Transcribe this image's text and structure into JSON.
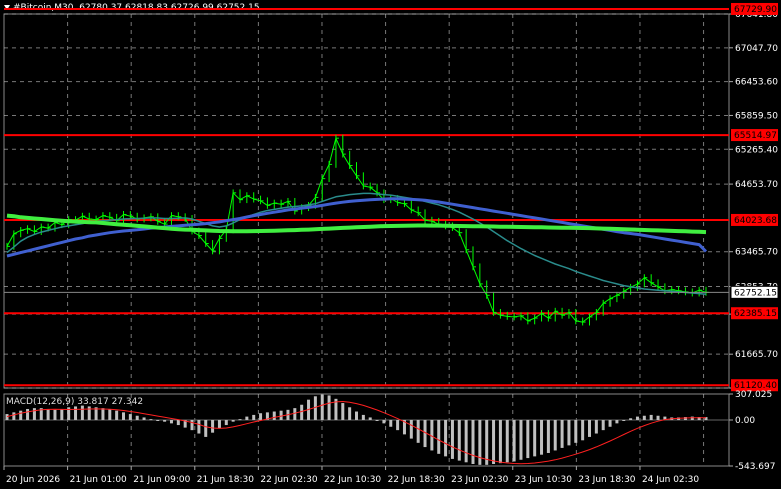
{
  "header": {
    "symbol_timeframe": "#Bitcoin,M30",
    "ohlc": "62780.37 62818.83 62726.99 62752.15"
  },
  "price_axis": {
    "ticks": [
      "67641.80",
      "67047.70",
      "66453.60",
      "65859.50",
      "65265.40",
      "64653.70",
      "63465.70",
      "62853.70",
      "62369.50",
      "61665.70",
      "61071.60"
    ],
    "current_price": "62752.15"
  },
  "levels": [
    {
      "label": "67729.90",
      "price": 67729.9
    },
    {
      "label": "65514.97",
      "price": 65514.97
    },
    {
      "label": "64023.68",
      "price": 64023.68
    },
    {
      "label": "62385.15",
      "price": 62385.15
    },
    {
      "label": "61120.40",
      "price": 61120.4
    }
  ],
  "macd": {
    "label": "MACD(12,26,9) 33.817 27.342",
    "ticks": [
      "307.025",
      "0.00",
      "-543.697"
    ]
  },
  "time_axis": [
    "20 Jun 2026",
    "21 Jun 01:00",
    "21 Jun 09:00",
    "21 Jun 18:30",
    "22 Jun 02:30",
    "22 Jun 10:30",
    "22 Jun 18:30",
    "23 Jun 02:30",
    "23 Jun 10:30",
    "23 Jun 18:30",
    "24 Jun 02:30"
  ],
  "colors": {
    "background": "#000000",
    "grid": "#c8c8c8",
    "level": "#ff0000",
    "candles": "#00ff00",
    "ma_fast": "#2a8c8c",
    "ma_mid": "#4060d0",
    "ma_slow": "#40ee40",
    "macd_hist": "#c0c0c0",
    "macd_signal": "#ff2020"
  },
  "chart_data": {
    "type": "line",
    "series": [
      {
        "values": [
          63560,
          63780,
          63840,
          63870,
          63820,
          63900,
          63880,
          63980,
          63940,
          64030,
          64020,
          64090,
          64040,
          64030,
          64100,
          64070,
          64010,
          64120,
          64090,
          64040,
          64060,
          64080,
          64000,
          63950,
          64100,
          64080,
          64050,
          63830,
          63750,
          63610,
          63480,
          63700,
          63850,
          64500,
          64380,
          64450,
          64390,
          64360,
          64280,
          64320,
          64300,
          64350,
          64180,
          64240,
          64280,
          64420,
          64750,
          65000,
          65460,
          65180,
          64980,
          64800,
          64620,
          64600,
          64500,
          64380,
          64400,
          64330,
          64310,
          64200,
          64150,
          64020,
          64000,
          63950,
          63920,
          63890,
          63800,
          63500,
          63200,
          62900,
          62700,
          62400,
          62350,
          62330,
          62320,
          62340,
          62250,
          62300,
          62380,
          62300,
          62420,
          62350,
          62400,
          62250,
          62230,
          62320,
          62400,
          62560,
          62640,
          62700,
          62770,
          62840,
          62900,
          63010,
          62920,
          62850,
          62780,
          62800,
          62780,
          62760,
          62740,
          62790,
          62752
        ]
      },
      {
        "values": [
          63450,
          63550,
          63650,
          63720,
          63770,
          63810,
          63840,
          63870,
          63900,
          63920,
          63940,
          63960,
          63980,
          64000,
          64010,
          64020,
          64030,
          64040,
          64045,
          64050,
          64055,
          64060,
          64058,
          64050,
          64050,
          64055,
          64060,
          64040,
          64000,
          63960,
          63920,
          63900,
          63920,
          63970,
          64030,
          64080,
          64120,
          64160,
          64190,
          64210,
          64230,
          64250,
          64260,
          64270,
          64290,
          64310,
          64350,
          64390,
          64430,
          64450,
          64470,
          64480,
          64490,
          64490,
          64480,
          64470,
          64460,
          64440,
          64420,
          64400,
          64380,
          64350,
          64320,
          64290,
          64250,
          64210,
          64160,
          64100,
          64040,
          63970,
          63900,
          63820,
          63740,
          63660,
          63590,
          63520,
          63460,
          63400,
          63350,
          63300,
          63250,
          63210,
          63170,
          63120,
          63080,
          63040,
          63000,
          62960,
          62930,
          62900,
          62870,
          62850,
          62830,
          62810,
          62800,
          62790,
          62780,
          62770,
          62760,
          62750,
          62740,
          62730,
          62720
        ]
      },
      {
        "values": [
          63390,
          63420,
          63450,
          63480,
          63510,
          63540,
          63570,
          63600,
          63630,
          63660,
          63690,
          63710,
          63740,
          63760,
          63780,
          63800,
          63815,
          63830,
          63840,
          63850,
          63865,
          63880,
          63890,
          63900,
          63910,
          63920,
          63930,
          63940,
          63950,
          63960,
          63975,
          63990,
          64010,
          64030,
          64050,
          64075,
          64100,
          64120,
          64140,
          64160,
          64180,
          64200,
          64215,
          64230,
          64245,
          64260,
          64280,
          64300,
          64320,
          64335,
          64350,
          64360,
          64370,
          64380,
          64385,
          64390,
          64395,
          64395,
          64390,
          64385,
          64380,
          64370,
          64355,
          64340,
          64320,
          64300,
          64280,
          64260,
          64240,
          64220,
          64200,
          64180,
          64160,
          64140,
          64120,
          64100,
          64080,
          64060,
          64040,
          64020,
          64000,
          63980,
          63960,
          63940,
          63920,
          63900,
          63880,
          63860,
          63840,
          63820,
          63800,
          63785,
          63770,
          63750,
          63730,
          63710,
          63690,
          63670,
          63650,
          63630,
          63610,
          63590,
          63470
        ]
      },
      {
        "values": [
          64100,
          64090,
          64070,
          64060,
          64050,
          64040,
          64030,
          64020,
          64010,
          64000,
          63995,
          63990,
          63985,
          63980,
          63970,
          63960,
          63950,
          63940,
          63930,
          63920,
          63910,
          63900,
          63890,
          63880,
          63870,
          63860,
          63855,
          63850,
          63845,
          63840,
          63835,
          63830,
          63828,
          63826,
          63825,
          63826,
          63828,
          63830,
          63832,
          63835,
          63838,
          63842,
          63846,
          63850,
          63855,
          63860,
          63866,
          63872,
          63878,
          63885,
          63890,
          63895,
          63900,
          63905,
          63910,
          63915,
          63918,
          63920,
          63922,
          63924,
          63926,
          63926,
          63925,
          63924,
          63922,
          63920,
          63918,
          63916,
          63914,
          63912,
          63910,
          63908,
          63906,
          63904,
          63902,
          63900,
          63898,
          63896,
          63894,
          63892,
          63890,
          63888,
          63886,
          63884,
          63882,
          63880,
          63876,
          63872,
          63868,
          63864,
          63860,
          63856,
          63852,
          63848,
          63844,
          63840,
          63836,
          63832,
          63828,
          63824,
          63820,
          63816,
          63810
        ]
      }
    ],
    "macd_histogram": [
      70,
      90,
      110,
      130,
      140,
      140,
      130,
      120,
      130,
      150,
      160,
      170,
      160,
      150,
      140,
      130,
      110,
      90,
      70,
      50,
      30,
      10,
      0,
      -20,
      -40,
      -60,
      -90,
      -120,
      -160,
      -200,
      -150,
      -100,
      -60,
      -20,
      10,
      40,
      60,
      80,
      90,
      100,
      110,
      120,
      140,
      180,
      240,
      280,
      300,
      290,
      250,
      200,
      150,
      100,
      60,
      30,
      0,
      -40,
      -80,
      -120,
      -170,
      -220,
      -270,
      -320,
      -360,
      -400,
      -430,
      -460,
      -480,
      -500,
      -520,
      -530,
      -530,
      -520,
      -510,
      -500,
      -490,
      -470,
      -450,
      -430,
      -410,
      -390,
      -360,
      -330,
      -300,
      -270,
      -240,
      -200,
      -160,
      -120,
      -80,
      -40,
      -10,
      20,
      40,
      50,
      60,
      50,
      40,
      30,
      30,
      35,
      40,
      35,
      34
    ],
    "macd_signal": [
      40,
      60,
      80,
      95,
      110,
      120,
      125,
      126,
      125,
      124,
      125,
      128,
      130,
      131,
      130,
      128,
      122,
      112,
      100,
      88,
      74,
      60,
      46,
      32,
      18,
      4,
      -12,
      -30,
      -52,
      -80,
      -95,
      -100,
      -95,
      -82,
      -64,
      -44,
      -24,
      -6,
      12,
      30,
      46,
      62,
      80,
      100,
      124,
      150,
      176,
      200,
      214,
      218,
      210,
      194,
      172,
      146,
      118,
      86,
      52,
      16,
      -22,
      -62,
      -104,
      -148,
      -192,
      -236,
      -278,
      -318,
      -354,
      -388,
      -418,
      -444,
      -466,
      -484,
      -498,
      -508,
      -514,
      -516,
      -514,
      -508,
      -498,
      -486,
      -470,
      -450,
      -428,
      -404,
      -378,
      -350,
      -318,
      -284,
      -248,
      -210,
      -172,
      -134,
      -98,
      -66,
      -38,
      -14,
      4,
      14,
      20,
      24,
      26,
      27,
      27
    ],
    "ylim": [
      61071.6,
      67641.8
    ],
    "macd_ylim": [
      -543.697,
      307.025
    ]
  }
}
